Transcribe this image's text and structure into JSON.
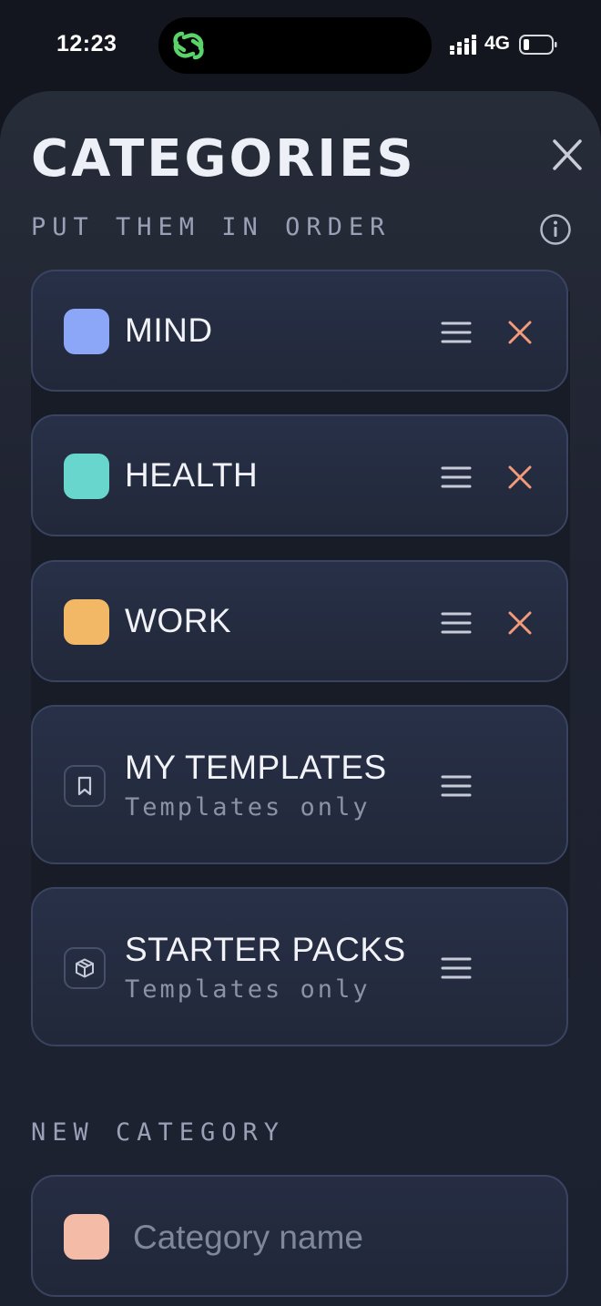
{
  "status": {
    "time": "12:23",
    "network": "4G"
  },
  "header": {
    "title": "CATEGORIES",
    "subtitle": "PUT THEM IN ORDER"
  },
  "categories": [
    {
      "label": "MIND",
      "color": "#8ca6f8",
      "removable": true
    },
    {
      "label": "HEALTH",
      "color": "#68d6cc",
      "removable": true
    },
    {
      "label": "WORK",
      "color": "#f2b865",
      "removable": true
    },
    {
      "label": "MY TEMPLATES",
      "sublabel": "Templates only",
      "icon": "bookmark-icon"
    },
    {
      "label": "STARTER PACKS",
      "sublabel": "Templates only",
      "icon": "box-icon"
    }
  ],
  "new_category": {
    "section_label": "NEW CATEGORY",
    "placeholder": "Category name",
    "value": "",
    "color": "#f4bca7"
  },
  "colors": {
    "remove": "#f29a7a",
    "handle": "#c7cbd8"
  }
}
